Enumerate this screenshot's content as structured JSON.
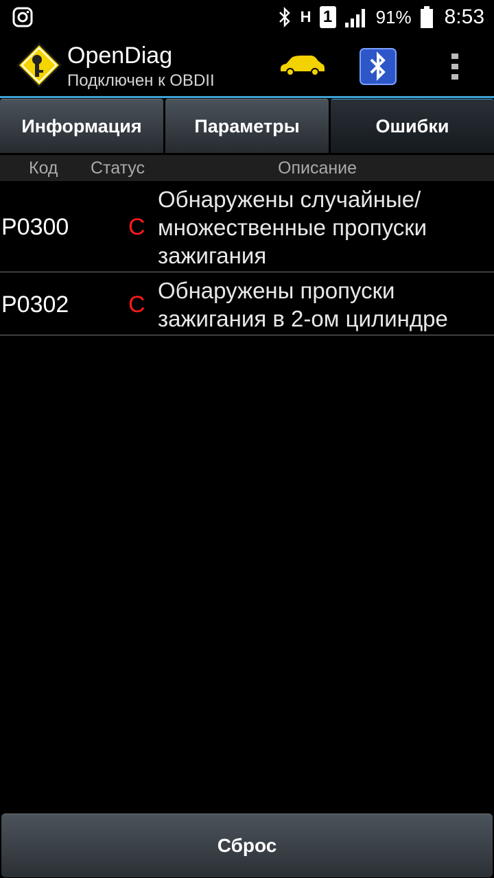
{
  "status_bar": {
    "left_icon": "instagram-icon",
    "network": "H",
    "sim": "1",
    "battery": "91%",
    "time": "8:53"
  },
  "app": {
    "title": "OpenDiag",
    "subtitle": "Подключен к OBDII",
    "car_color": "#f2d200"
  },
  "tabs": [
    {
      "label": "Информация"
    },
    {
      "label": "Параметры"
    },
    {
      "label": "Ошибки"
    }
  ],
  "table": {
    "headers": {
      "code": "Код",
      "status": "Статус",
      "description": "Описание"
    },
    "rows": [
      {
        "code": "P0300",
        "status": "C",
        "description": "Обнаружены случайные/ множественные пропуски зажигания"
      },
      {
        "code": "P0302",
        "status": "C",
        "description": "Обнаружены пропуски зажигания в 2-ом цилиндре"
      }
    ]
  },
  "reset_label": "Сброс",
  "colors": {
    "accent": "#3ea3d6",
    "status_red": "#ff1a1a"
  }
}
